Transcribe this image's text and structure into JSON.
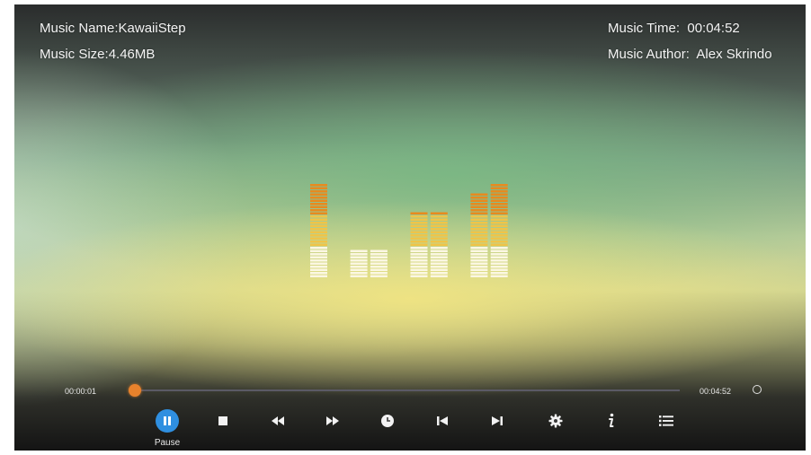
{
  "music": {
    "name_label": "Music Name:",
    "name_value": "KawaiiStep",
    "size_label": "Music Size:",
    "size_value": "4.46MB",
    "time_label": "Music Time:",
    "time_value": "00:04:52",
    "author_label": "Music Author:",
    "author_value": "Alex Skrindo"
  },
  "progress": {
    "current_time": "00:00:01",
    "total_time": "00:04:52",
    "fraction": 0.003
  },
  "controls": {
    "pause_label": "Pause",
    "buttons": [
      "pause-icon",
      "stop-icon",
      "rewind-icon",
      "fast-forward-icon",
      "clock-icon",
      "skip-previous-icon",
      "skip-next-icon",
      "gear-icon",
      "info-icon",
      "playlist-icon"
    ]
  },
  "equalizer": {
    "levels": [
      10,
      0,
      3,
      3,
      0,
      7,
      7,
      0,
      9,
      10
    ]
  },
  "colors": {
    "accent": "#2f8fe0",
    "progress_thumb": "#e8822c",
    "eq_low": "#fbf7e2",
    "eq_mid": "#efc448",
    "eq_high": "#e88a1e"
  }
}
